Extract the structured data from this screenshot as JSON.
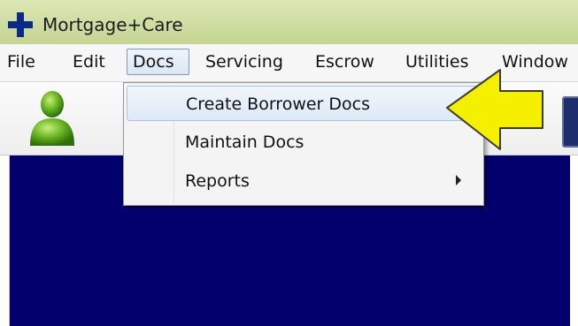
{
  "window": {
    "title": "Mortgage+Care",
    "icon": "blue-cross-icon"
  },
  "menubar": {
    "items": [
      {
        "label": "File"
      },
      {
        "label": "Edit"
      },
      {
        "label": "Docs",
        "active": true
      },
      {
        "label": "Servicing"
      },
      {
        "label": "Escrow"
      },
      {
        "label": "Utilities"
      },
      {
        "label": "Window"
      }
    ]
  },
  "toolbar": {
    "icons": [
      "user-icon",
      "toolbar-button-icon"
    ]
  },
  "docs_menu": {
    "items": [
      {
        "label": "Create Borrower Docs",
        "highlighted": true
      },
      {
        "label": "Maintain Docs"
      },
      {
        "label": "Reports",
        "has_submenu": true
      }
    ]
  },
  "annotation": {
    "icon": "yellow-arrow-icon",
    "points_to": "Create Borrower Docs"
  },
  "colors": {
    "titlebar": "#cfdca2",
    "workspace": "#01006d",
    "highlight": "#dde9f7",
    "arrow": "#f5f000",
    "app_icon": "#0a2a8a"
  }
}
